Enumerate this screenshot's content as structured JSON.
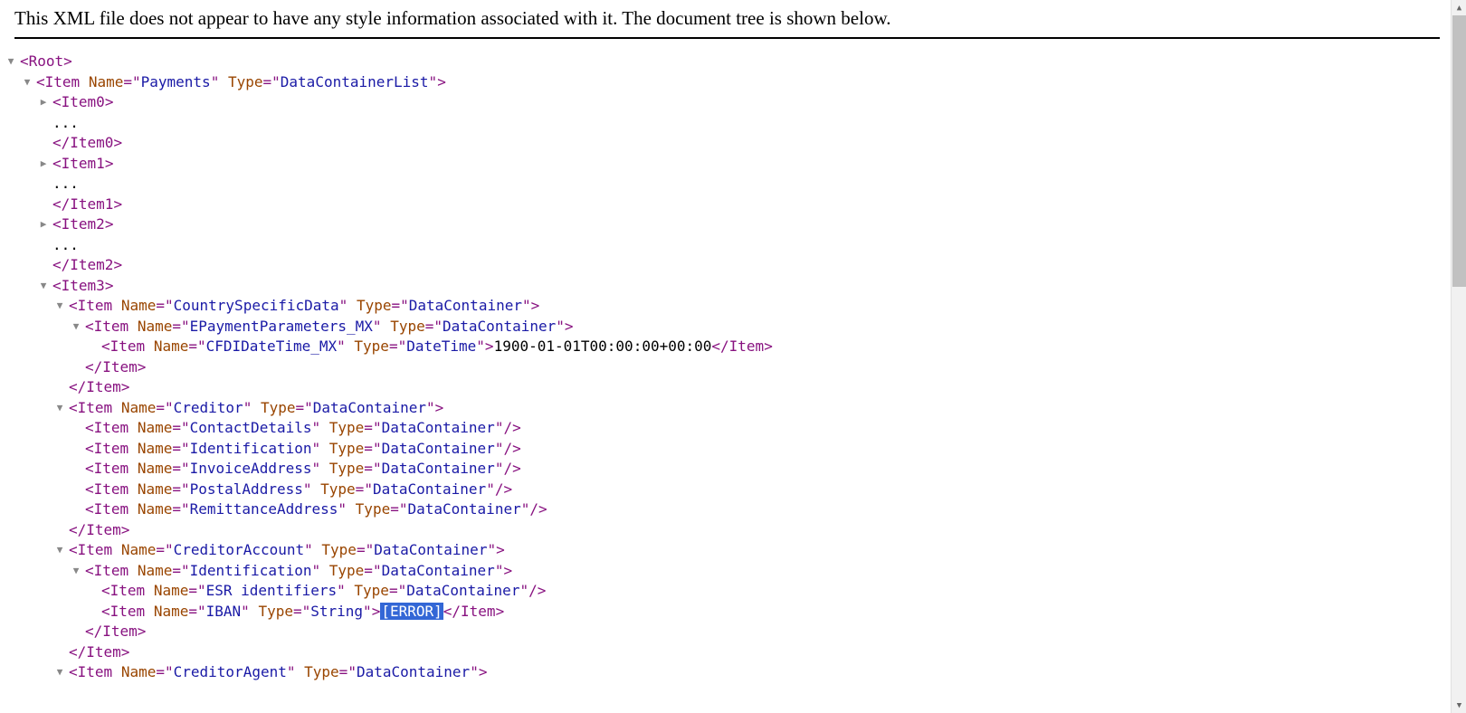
{
  "header": "This XML file does not appear to have any style information associated with it. The document tree is shown below.",
  "punct": {
    "lt": "<",
    "gt": ">",
    "lts": "</",
    "sc": "/>",
    "eq": "=",
    "q": "\""
  },
  "ellipsis": "...",
  "xml": {
    "root": {
      "tag": "Root"
    },
    "payments": {
      "tag": "Item",
      "attrs": [
        [
          "Name",
          "Payments"
        ],
        [
          "Type",
          "DataContainerList"
        ]
      ]
    },
    "item0": {
      "tag": "Item0"
    },
    "item1": {
      "tag": "Item1"
    },
    "item2": {
      "tag": "Item2"
    },
    "item3": {
      "tag": "Item3"
    },
    "csd": {
      "tag": "Item",
      "attrs": [
        [
          "Name",
          "CountrySpecificData"
        ],
        [
          "Type",
          "DataContainer"
        ]
      ]
    },
    "epay": {
      "tag": "Item",
      "attrs": [
        [
          "Name",
          "EPaymentParameters_MX"
        ],
        [
          "Type",
          "DataContainer"
        ]
      ]
    },
    "cfdi": {
      "tag": "Item",
      "attrs": [
        [
          "Name",
          "CFDIDateTime_MX"
        ],
        [
          "Type",
          "DateTime"
        ]
      ],
      "text": "1900-01-01T00:00:00+00:00"
    },
    "creditor": {
      "tag": "Item",
      "attrs": [
        [
          "Name",
          "Creditor"
        ],
        [
          "Type",
          "DataContainer"
        ]
      ]
    },
    "contact": {
      "tag": "Item",
      "attrs": [
        [
          "Name",
          "ContactDetails"
        ],
        [
          "Type",
          "DataContainer"
        ]
      ]
    },
    "ident": {
      "tag": "Item",
      "attrs": [
        [
          "Name",
          "Identification"
        ],
        [
          "Type",
          "DataContainer"
        ]
      ]
    },
    "invaddr": {
      "tag": "Item",
      "attrs": [
        [
          "Name",
          "InvoiceAddress"
        ],
        [
          "Type",
          "DataContainer"
        ]
      ]
    },
    "postaddr": {
      "tag": "Item",
      "attrs": [
        [
          "Name",
          "PostalAddress"
        ],
        [
          "Type",
          "DataContainer"
        ]
      ]
    },
    "remaddr": {
      "tag": "Item",
      "attrs": [
        [
          "Name",
          "RemittanceAddress"
        ],
        [
          "Type",
          "DataContainer"
        ]
      ]
    },
    "credacct": {
      "tag": "Item",
      "attrs": [
        [
          "Name",
          "CreditorAccount"
        ],
        [
          "Type",
          "DataContainer"
        ]
      ]
    },
    "ident2": {
      "tag": "Item",
      "attrs": [
        [
          "Name",
          "Identification"
        ],
        [
          "Type",
          "DataContainer"
        ]
      ]
    },
    "esr": {
      "tag": "Item",
      "attrs": [
        [
          "Name",
          "ESR identifiers"
        ],
        [
          "Type",
          "DataContainer"
        ]
      ]
    },
    "iban": {
      "tag": "Item",
      "attrs": [
        [
          "Name",
          "IBAN"
        ],
        [
          "Type",
          "String"
        ]
      ],
      "text": "[ERROR]"
    },
    "credagent": {
      "tag": "Item",
      "attrs": [
        [
          "Name",
          "CreditorAgent"
        ],
        [
          "Type",
          "DataContainer"
        ]
      ]
    }
  }
}
